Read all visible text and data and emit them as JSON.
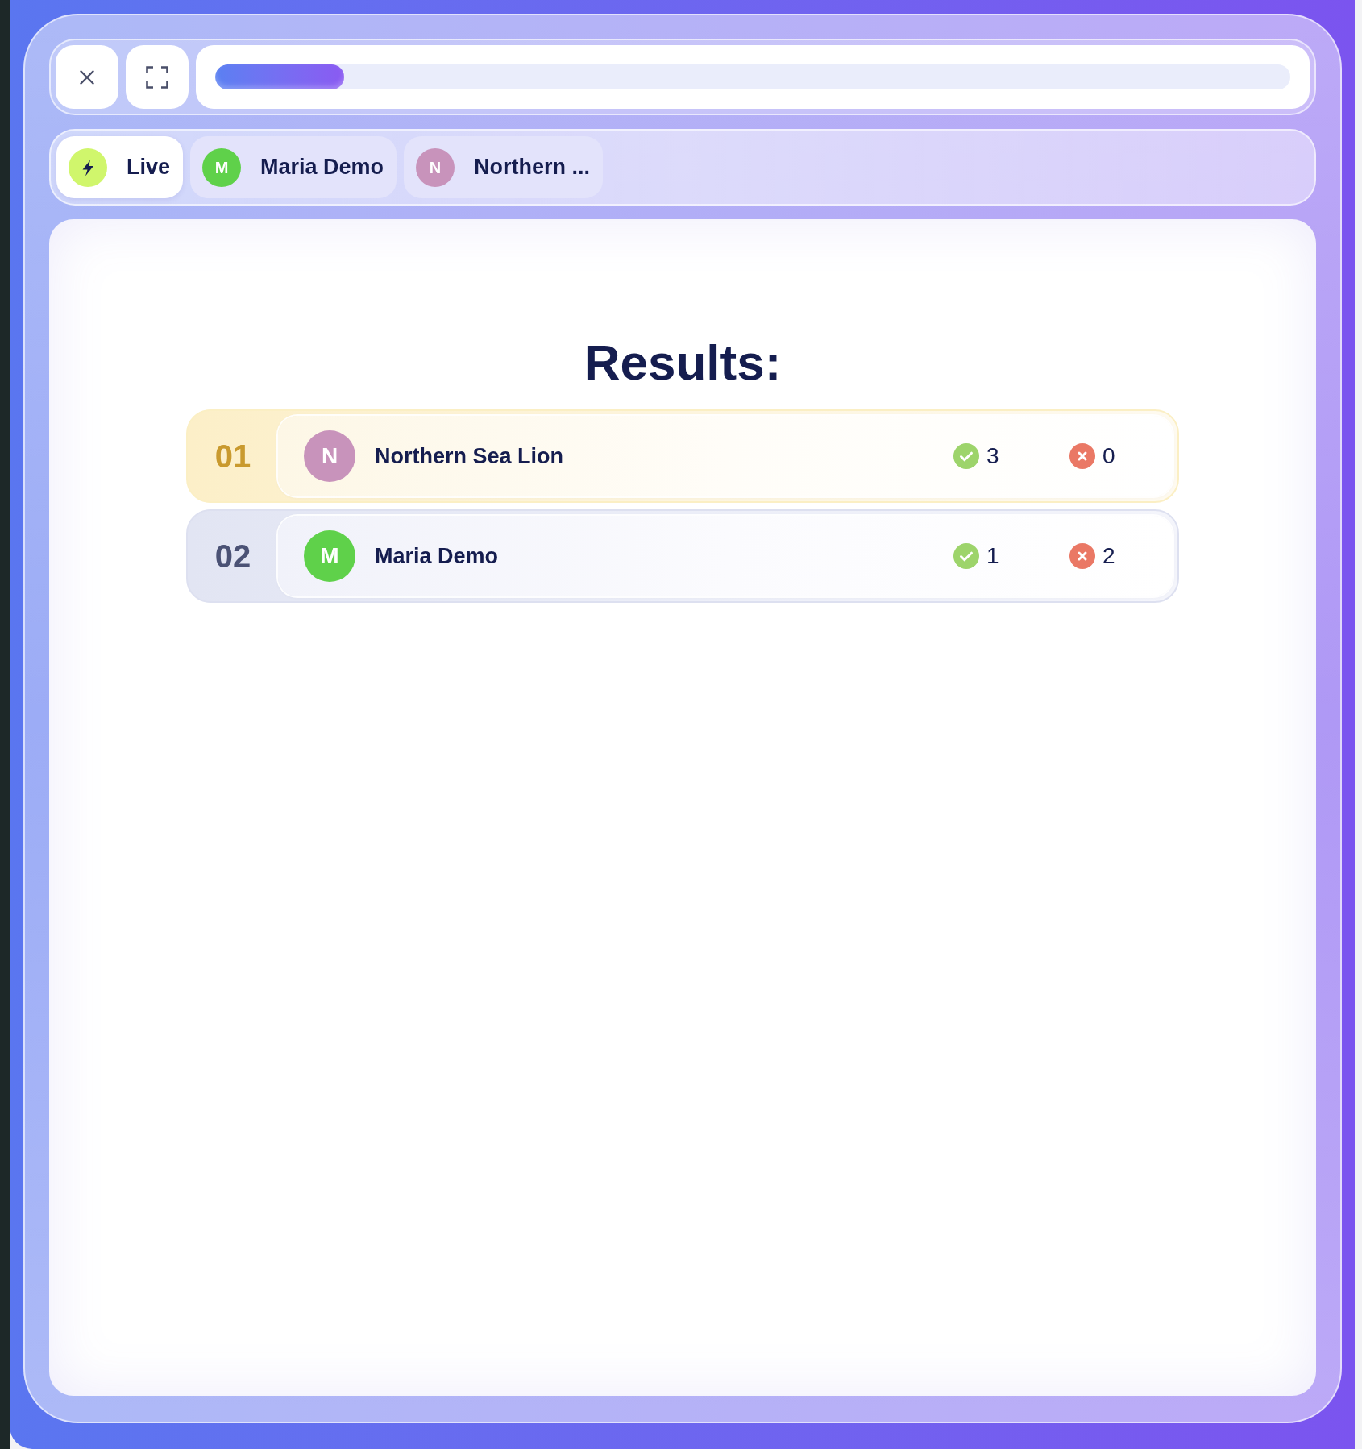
{
  "progress": {
    "level": 0.12
  },
  "tabs": [
    {
      "kind": "live",
      "label": "Live",
      "selected": true
    },
    {
      "kind": "player",
      "initial": "M",
      "color": "#5fd14a",
      "label": "Maria Demo",
      "selected": false
    },
    {
      "kind": "player",
      "initial": "N",
      "color": "#c893bb",
      "label": "Northern ...",
      "selected": false
    }
  ],
  "results": {
    "title": "Results:",
    "rows": [
      {
        "kind": "gold",
        "rank": "01",
        "initial": "N",
        "color": "#c893bb",
        "name": "Northern Sea Lion",
        "correct": "3",
        "wrong": "0"
      },
      {
        "kind": "silver",
        "rank": "02",
        "initial": "M",
        "color": "#5fd14a",
        "name": "Maria Demo",
        "correct": "1",
        "wrong": "2"
      }
    ]
  }
}
